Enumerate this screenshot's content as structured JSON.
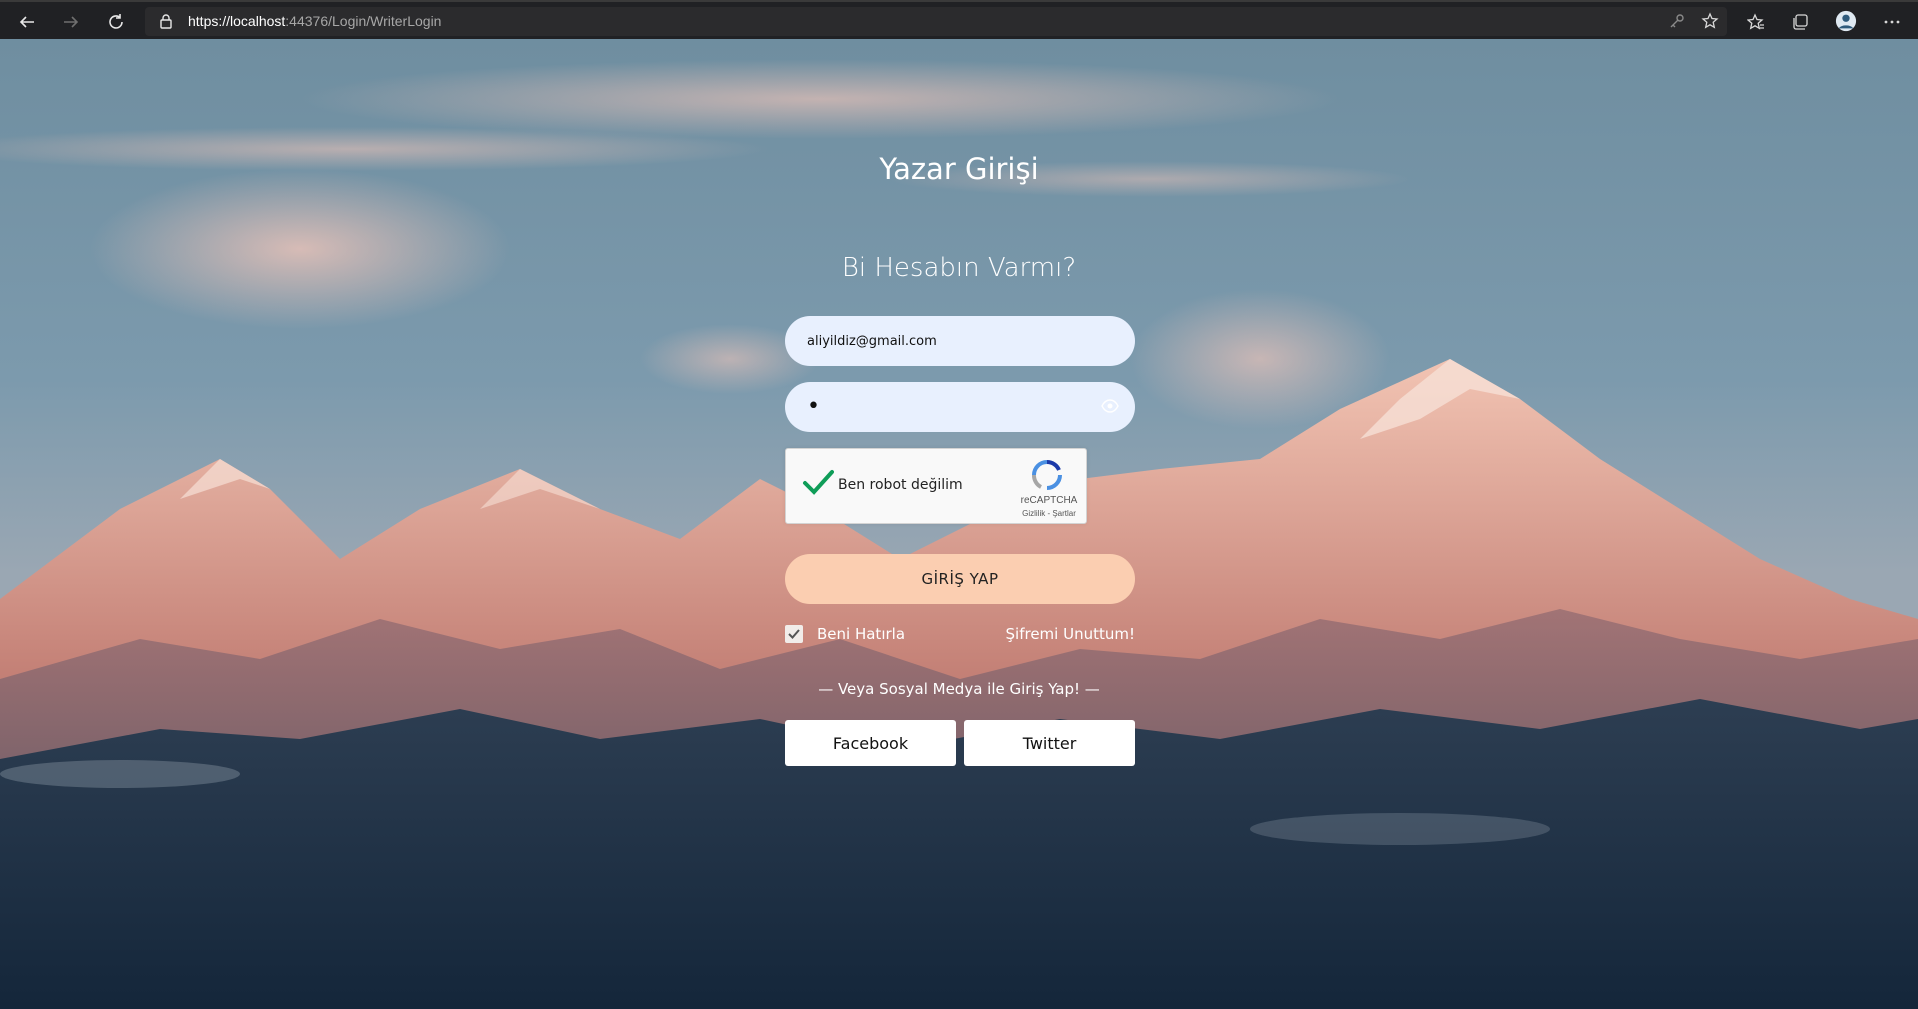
{
  "browser": {
    "url_scheme_host": "https://localhost",
    "url_rest": ":44376/Login/WriterLogin"
  },
  "login": {
    "title": "Yazar Girişi",
    "subtitle": "Bi Hesabın Varmı?",
    "email_value": "aliyildiz@gmail.com",
    "password_mask": "•",
    "captcha_label": "Ben robot değilim",
    "captcha_brand": "reCAPTCHA",
    "captcha_terms": "Gizlilik - Şartlar",
    "login_button": "GİRİŞ YAP",
    "remember_label": "Beni Hatırla",
    "remember_checked": true,
    "forgot_label": "Şifremi Unuttum!",
    "social_caption": "— Veya Sosyal Medya ile Giriş Yap! —",
    "facebook_label": "Facebook",
    "twitter_label": "Twitter"
  },
  "colors": {
    "login_button": "#fbceb1",
    "input_bg": "#e8f0fe",
    "captcha_check": "#0f9d58"
  }
}
